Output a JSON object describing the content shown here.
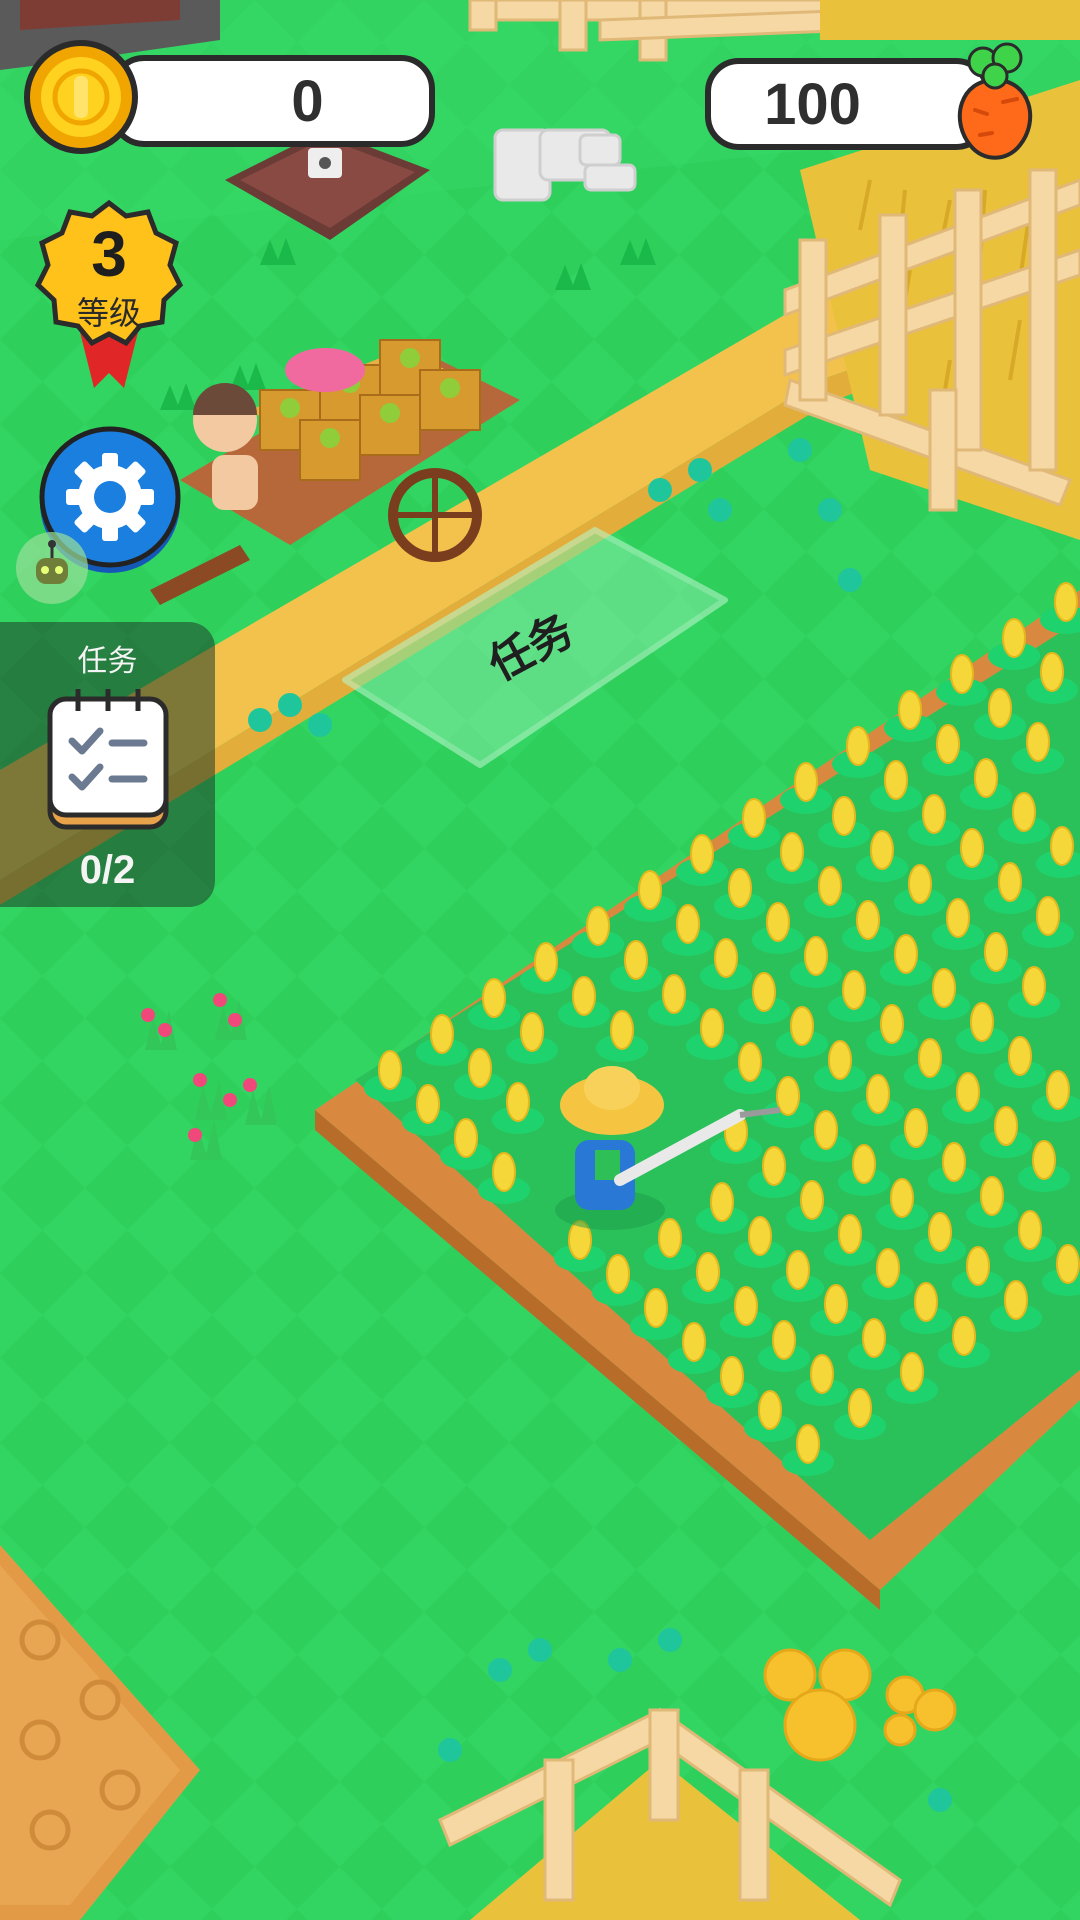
{
  "hud": {
    "coins": "0",
    "carrots": "100"
  },
  "level": {
    "number": "3",
    "label": "等级"
  },
  "task": {
    "title": "任务",
    "progress": "0/2"
  },
  "zone": {
    "label": "任务"
  },
  "colors": {
    "grass": "#2fcf5c",
    "path": "#f3c24d",
    "soil": "#d9893f",
    "fence": "#f5d8a3",
    "wheat": "#e9c13b",
    "corn": "#f5d73a",
    "settings_blue": "#1b7fe0",
    "badge_yellow": "#ffc21a"
  },
  "icons": {
    "coin": "coin-icon",
    "carrot": "carrot-icon",
    "level": "level-badge-icon",
    "settings": "gear-icon",
    "task": "checklist-icon"
  }
}
